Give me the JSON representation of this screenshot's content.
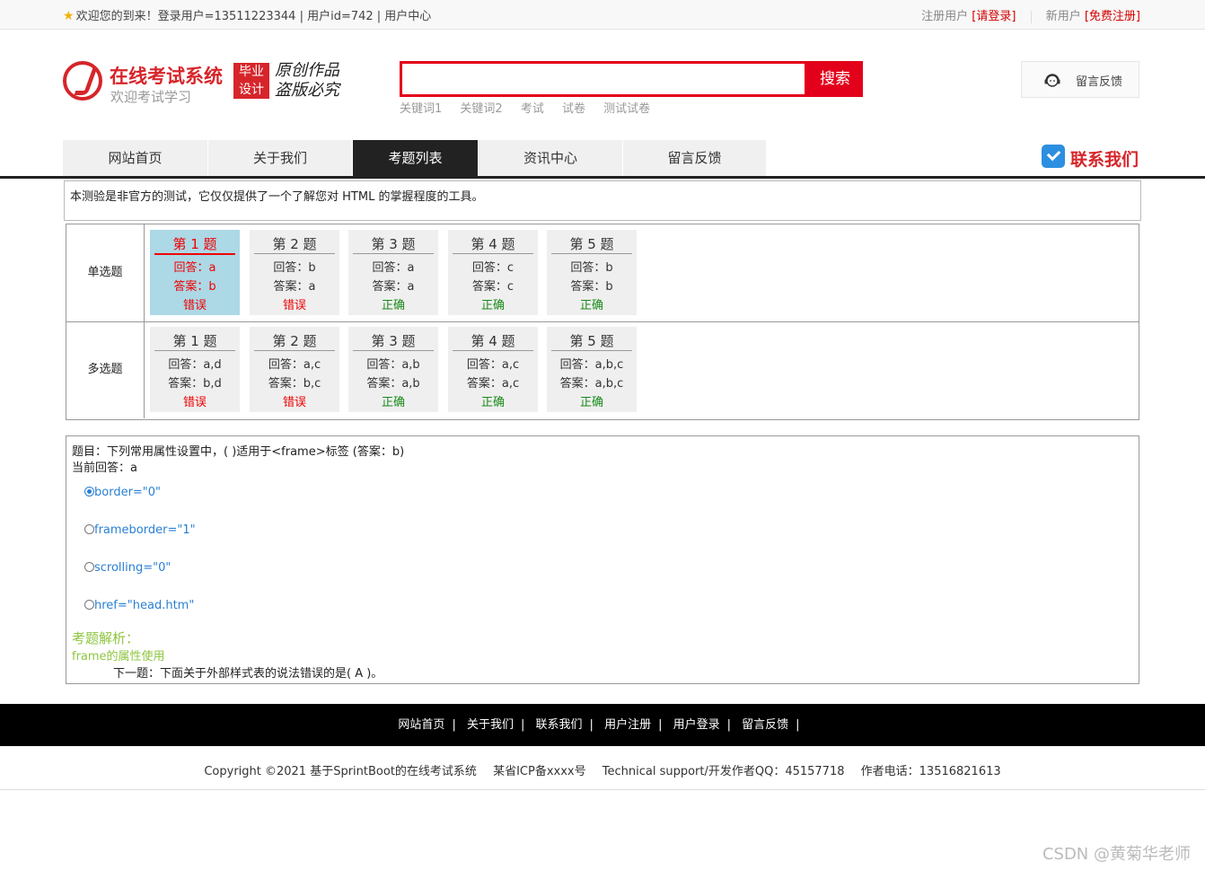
{
  "topbar": {
    "welcome": "欢迎您的到来！登录用户=13511223344 | 用户id=742 | 用户中心",
    "register_label": "注册用户",
    "login_link": "[请登录]",
    "new_user_label": "新用户",
    "free_register_link": "[免费注册]"
  },
  "logo": {
    "title": "在线考试系统",
    "subtitle": "欢迎考试学习",
    "badge_line1": "毕业",
    "badge_line2": "设计",
    "slogan_line1": "原创作品",
    "slogan_line2": "盗版必究"
  },
  "search": {
    "placeholder": "",
    "button": "搜索",
    "keywords": [
      "关键词1",
      "关键词2",
      "考试",
      "试卷",
      "测试试卷"
    ]
  },
  "feedback_button": "留言反馈",
  "nav": {
    "items": [
      "网站首页",
      "关于我们",
      "考题列表",
      "资讯中心",
      "留言反馈"
    ],
    "active_index": 2,
    "contact": "联系我们"
  },
  "notice": "本测验是非官方的测试，它仅仅提供了一个了解您对 HTML 的掌握程度的工具。",
  "results": {
    "single": {
      "label": "单选题",
      "cards": [
        {
          "title": "第 1 题",
          "answer": "回答：a",
          "correct": "答案：b",
          "status": "错误"
        },
        {
          "title": "第 2 题",
          "answer": "回答：b",
          "correct": "答案：a",
          "status": "错误"
        },
        {
          "title": "第 3 题",
          "answer": "回答：a",
          "correct": "答案：a",
          "status": "正确"
        },
        {
          "title": "第 4 题",
          "answer": "回答：c",
          "correct": "答案：c",
          "status": "正确"
        },
        {
          "title": "第 5 题",
          "answer": "回答：b",
          "correct": "答案：b",
          "status": "正确"
        }
      ]
    },
    "multi": {
      "label": "多选题",
      "cards": [
        {
          "title": "第 1 题",
          "answer": "回答：a,d",
          "correct": "答案：b,d",
          "status": "错误"
        },
        {
          "title": "第 2 题",
          "answer": "回答：a,c",
          "correct": "答案：b,c",
          "status": "错误"
        },
        {
          "title": "第 3 题",
          "answer": "回答：a,b",
          "correct": "答案：a,b",
          "status": "正确"
        },
        {
          "title": "第 4 题",
          "answer": "回答：a,c",
          "correct": "答案：a,c",
          "status": "正确"
        },
        {
          "title": "第 5 题",
          "answer": "回答：a,b,c",
          "correct": "答案：a,b,c",
          "status": "正确"
        }
      ]
    }
  },
  "question": {
    "title": "题目：下列常用属性设置中，( )适用于<frame>标签 (答案：b)",
    "current": "当前回答：a",
    "options": [
      "border=\"0\"",
      "frameborder=\"1\"",
      "scrolling=\"0\"",
      "href=\"head.htm\""
    ],
    "selected_index": 0,
    "analysis_title": "考题解析：",
    "analysis_text": "frame的属性使用",
    "next": "下一题：下面关于外部样式表的说法错误的是( A )。"
  },
  "footer": {
    "links": [
      "网站首页",
      "关于我们",
      "联系我们",
      "用户注册",
      "用户登录",
      "留言反馈"
    ],
    "separator": "|",
    "copyright": "Copyright ©2021 基于SprintBoot的在线考试系统",
    "icp": "某省ICP备xxxx号",
    "support": "Technical support/开发作者QQ：45157718",
    "phone": "作者电话：13516821613"
  },
  "watermark": "CSDN @黄菊华老师",
  "colors": {
    "brand_red": "#d6252a",
    "search_red": "#e3001b",
    "nav_active": "#222222",
    "selected_card": "#add8e6",
    "wrong": "#ee0000",
    "right": "#1a8a1a",
    "option_link": "#2a7fd4",
    "analysis": "#8dc63f"
  }
}
